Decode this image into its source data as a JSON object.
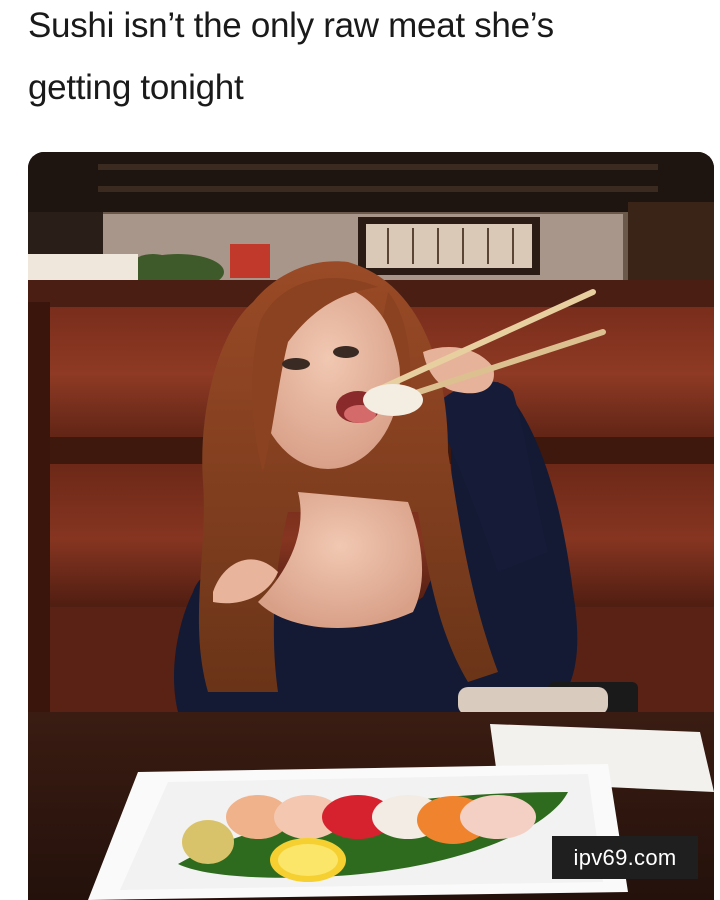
{
  "meme": {
    "caption_line1": "Sushi isn’t the only raw meat she’s",
    "caption_line2": "getting tonight"
  },
  "watermark": {
    "text": "ipv69.com"
  }
}
